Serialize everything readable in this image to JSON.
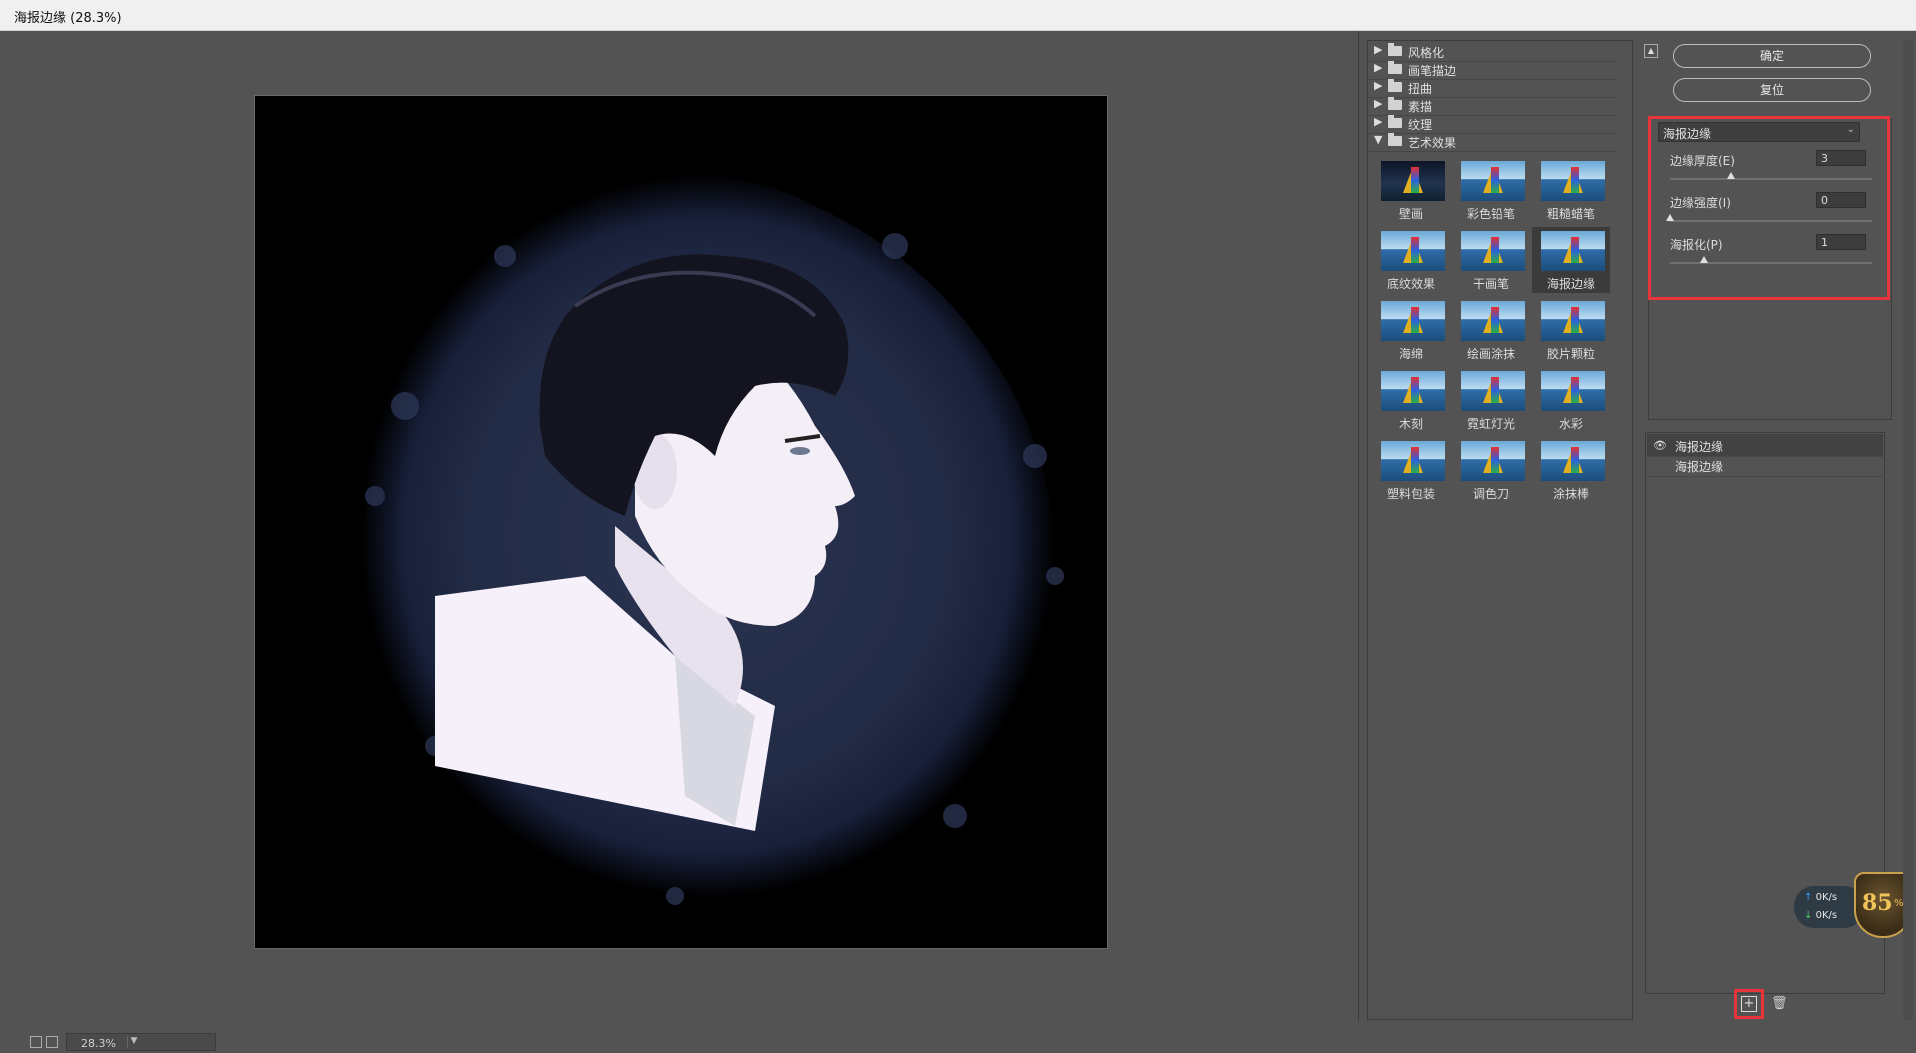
{
  "window": {
    "title": "海报边缘 (28.3%)"
  },
  "preview": {
    "zoom": "28.3%"
  },
  "gallery": {
    "categories": [
      {
        "label": "风格化",
        "expanded": false
      },
      {
        "label": "画笔描边",
        "expanded": false
      },
      {
        "label": "扭曲",
        "expanded": false
      },
      {
        "label": "素描",
        "expanded": false
      },
      {
        "label": "纹理",
        "expanded": false
      },
      {
        "label": "艺术效果",
        "expanded": true
      }
    ],
    "filters": [
      "壁画",
      "彩色铅笔",
      "粗糙蜡笔",
      "底纹效果",
      "干画笔",
      "海报边缘",
      "海绵",
      "绘画涂抹",
      "胶片颗粒",
      "木刻",
      "霓虹灯光",
      "水彩",
      "塑料包装",
      "调色刀",
      "涂抹棒"
    ],
    "selected_filter": "海报边缘"
  },
  "actions": {
    "ok": "确定",
    "reset": "复位"
  },
  "params": {
    "filter": "海报边缘",
    "edge_thickness": {
      "label": "边缘厚度(E)",
      "value": "3",
      "fraction": 0.3
    },
    "edge_intensity": {
      "label": "边缘强度(I)",
      "value": "0",
      "fraction": 0.0
    },
    "posterization": {
      "label": "海报化(P)",
      "value": "1",
      "fraction": 0.166
    }
  },
  "layers": [
    {
      "name": "海报边缘",
      "visible": true,
      "active": true
    },
    {
      "name": "海报边缘",
      "visible": false,
      "active": false
    }
  ],
  "network": {
    "up": "0K/s",
    "down": "0K/s"
  },
  "badge": {
    "value": "85",
    "unit": "%"
  },
  "colors": {
    "highlight": "#e8353b",
    "background": "#535353"
  }
}
